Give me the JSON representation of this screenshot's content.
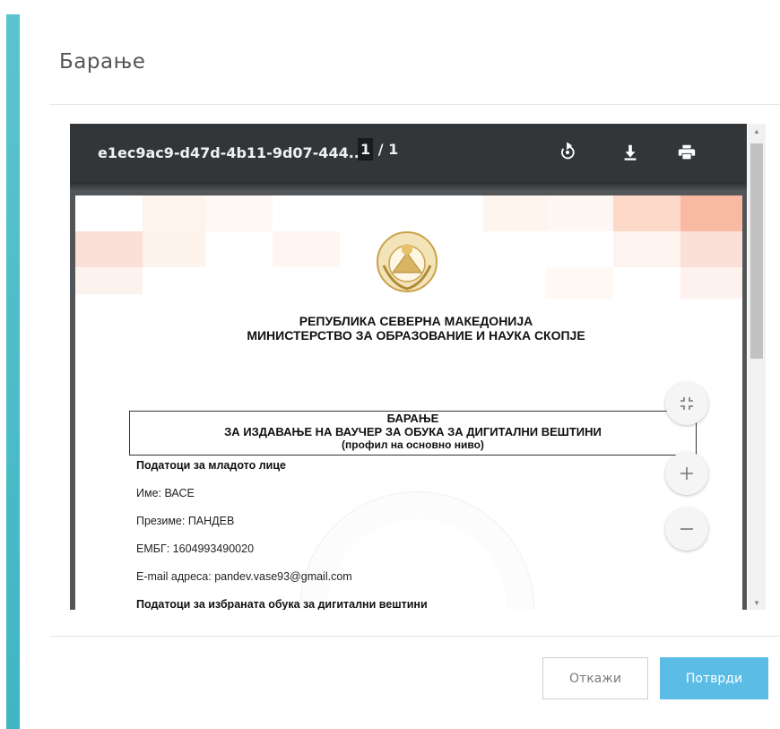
{
  "modal": {
    "title": "Барање",
    "cancel_label": "Откажи",
    "confirm_label": "Потврди"
  },
  "viewer": {
    "file_name": "e1ec9ac9-d47d-4b11-9d07-444...",
    "page_current": "1",
    "page_total": "/ 1",
    "toolbar_icons": [
      "rotate-icon",
      "download-icon",
      "print-icon"
    ],
    "zoom_icons": [
      "fit-page-icon",
      "zoom-in-icon",
      "zoom-out-icon"
    ]
  },
  "document": {
    "heading_line1": "РЕПУБЛИКА СЕВЕРНА МАКЕДОНИЈА",
    "heading_line2": "МИНИСТЕРСТВО ЗА ОБРАЗОВАНИЕ И НАУКА СКОПЈЕ",
    "request_title": "БАРАЊЕ",
    "request_subtitle": "ЗА ИЗДАВАЊЕ НА ВАУЧЕР ЗА ОБУКА ЗА ДИГИТАЛНИ ВЕШТИНИ",
    "request_profile": "(профил на основно ниво)",
    "section_young_person": "Податоци за младото лице",
    "name_line": "Име: ВАСЕ",
    "surname_line": "Презиме: ПАНДЕВ",
    "embg_line": "ЕМБГ: 1604993490020",
    "email_line": "E-mail адреса: pandev.vase93@gmail.com",
    "section_training": "Податоци за избраната обука за дигитални вештини"
  },
  "colors": {
    "accent": "#4fbfca",
    "confirm_button": "#5bbde6",
    "viewer_toolbar": "#323639"
  }
}
